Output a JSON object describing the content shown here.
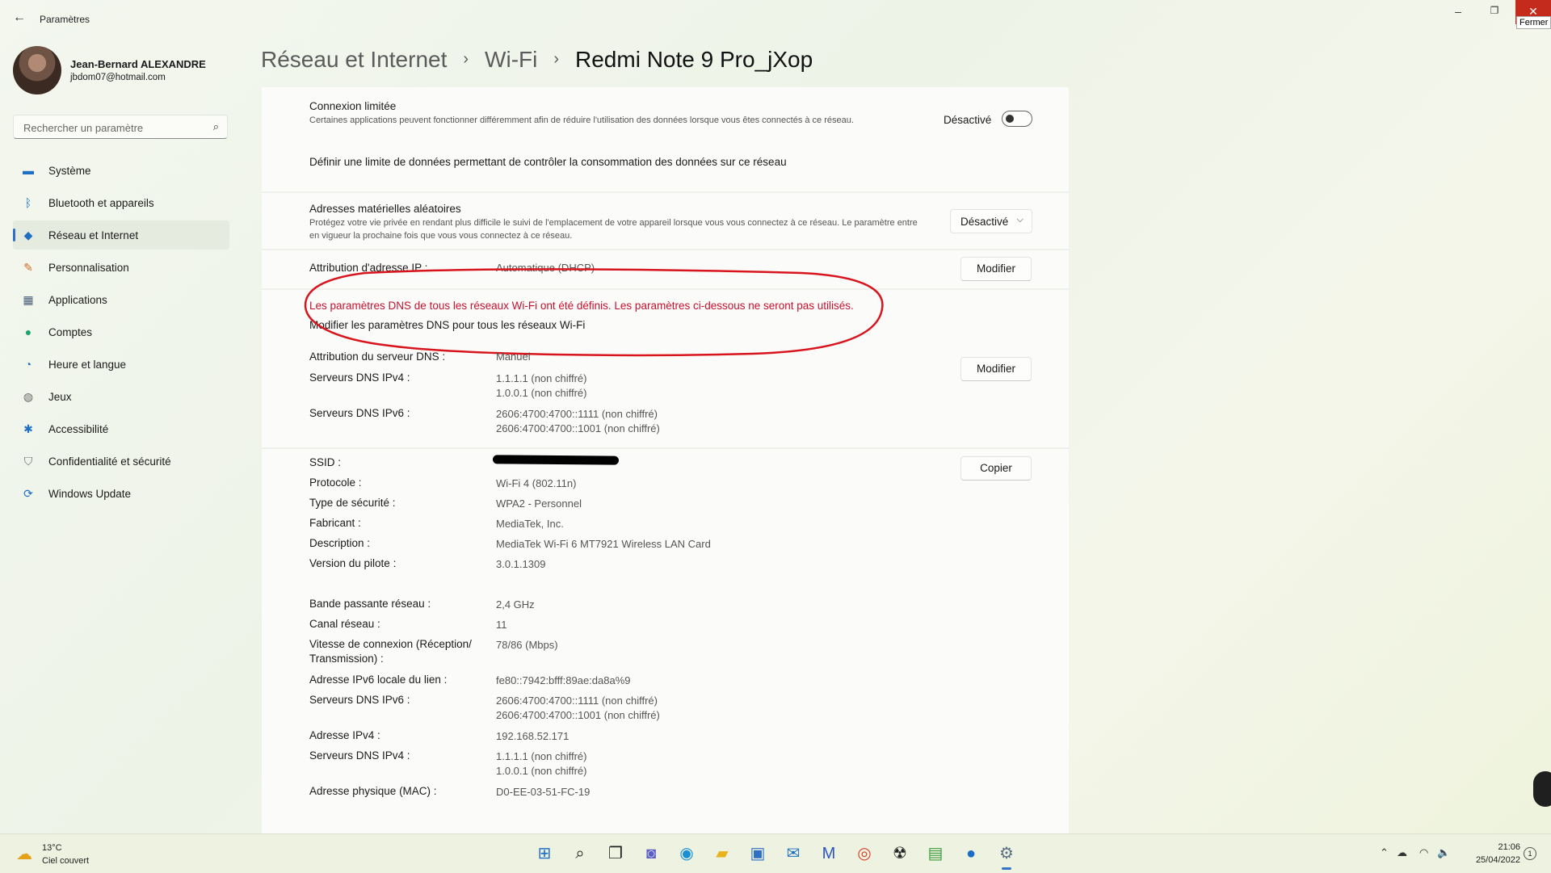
{
  "window": {
    "app_title": "Paramètres",
    "close_tooltip": "Fermer"
  },
  "user": {
    "name": "Jean-Bernard ALEXANDRE",
    "email": "jbdom07@hotmail.com"
  },
  "search": {
    "placeholder": "Rechercher un paramètre"
  },
  "sidebar": {
    "items": [
      {
        "label": "Système",
        "icon": "monitor-icon",
        "color": "#1f6fc4"
      },
      {
        "label": "Bluetooth et appareils",
        "icon": "bluetooth-icon",
        "color": "#1f6fc4"
      },
      {
        "label": "Réseau et Internet",
        "icon": "wifi-icon",
        "color": "#1f6fc4",
        "selected": true
      },
      {
        "label": "Personnalisation",
        "icon": "brush-icon",
        "color": "#d3691e"
      },
      {
        "label": "Applications",
        "icon": "apps-icon",
        "color": "#4a5f7a"
      },
      {
        "label": "Comptes",
        "icon": "person-icon",
        "color": "#1fa36e"
      },
      {
        "label": "Heure et langue",
        "icon": "globe-clock-icon",
        "color": "#1f6fc4"
      },
      {
        "label": "Jeux",
        "icon": "gamepad-icon",
        "color": "#6a6a6a"
      },
      {
        "label": "Accessibilité",
        "icon": "accessibility-icon",
        "color": "#1f6fc4"
      },
      {
        "label": "Confidentialité et sécurité",
        "icon": "shield-icon",
        "color": "#6a6a6a"
      },
      {
        "label": "Windows Update",
        "icon": "update-icon",
        "color": "#1f6fc4"
      }
    ]
  },
  "breadcrumb": {
    "level1": "Réseau et Internet",
    "level2": "Wi-Fi",
    "current": "Redmi Note 9 Pro_jXop",
    "separator": "›"
  },
  "metered": {
    "title": "Connexion limitée",
    "description": "Certaines applications peuvent fonctionner différemment afin de réduire l'utilisation des données lorsque vous êtes connectés à ce réseau.",
    "toggle_label": "Désactivé",
    "data_limit_link": "Définir une limite de données permettant de contrôler la consommation des données sur ce réseau"
  },
  "random_mac": {
    "title": "Adresses matérielles aléatoires",
    "description": "Protégez votre vie privée en rendant plus difficile le suivi de l'emplacement de votre appareil lorsque vous vous connectez à ce réseau. Le paramètre entre en vigueur la prochaine fois que vous vous connectez à ce réseau.",
    "selected": "Désactivé"
  },
  "ip": {
    "label": "Attribution d'adresse IP :",
    "value": "Automatique (DHCP)",
    "button": "Modifier"
  },
  "dns_warning": {
    "text": "Les paramètres DNS de tous les réseaux Wi-Fi ont été définis. Les paramètres ci-dessous ne seront pas utilisés.",
    "link": "Modifier les paramètres DNS pour tous les réseaux Wi-Fi"
  },
  "dns": {
    "assign_label": "Attribution du serveur DNS :",
    "assign_value": "Manuel",
    "ipv4_label": "Serveurs DNS IPv4 :",
    "ipv4_values": [
      "1.1.1.1 (non chiffré)",
      "1.0.0.1 (non chiffré)"
    ],
    "ipv6_label": "Serveurs DNS IPv6 :",
    "ipv6_values": [
      "2606:4700:4700::1111 (non chiffré)",
      "2606:4700:4700::1001 (non chiffré)"
    ],
    "button": "Modifier"
  },
  "properties": {
    "copy_button": "Copier",
    "rows": [
      {
        "label": "SSID :",
        "value": ""
      },
      {
        "label": "Protocole :",
        "value": "Wi-Fi 4 (802.11n)"
      },
      {
        "label": "Type de sécurité :",
        "value": "WPA2 - Personnel"
      },
      {
        "label": "Fabricant :",
        "value": "MediaTek, Inc."
      },
      {
        "label": "Description :",
        "value": "MediaTek Wi-Fi 6 MT7921 Wireless LAN Card"
      },
      {
        "label": "Version du pilote :",
        "value": "3.0.1.1309"
      },
      {
        "label": "Bande passante réseau :",
        "value": "2,4 GHz"
      },
      {
        "label": "Canal réseau :",
        "value": "11"
      },
      {
        "label": "Vitesse de connexion (Réception/",
        "label2": "Transmission) :",
        "value": "78/86 (Mbps)"
      },
      {
        "label": "Adresse IPv6 locale du lien :",
        "value": "fe80::7942:bfff:89ae:da8a%9"
      },
      {
        "label": "Serveurs DNS IPv6 :",
        "value": "2606:4700:4700::1111 (non chiffré)",
        "value2": "2606:4700:4700::1001 (non chiffré)"
      },
      {
        "label": "Adresse IPv4 :",
        "value": "192.168.52.171"
      },
      {
        "label": "Serveurs DNS IPv4 :",
        "value": "1.1.1.1 (non chiffré)",
        "value2": "1.0.0.1 (non chiffré)"
      },
      {
        "label": "Adresse physique (MAC) :",
        "value": "D0-EE-03-51-FC-19"
      }
    ]
  },
  "taskbar": {
    "weather_temp": "13°C",
    "weather_desc": "Ciel couvert",
    "time": "21:06",
    "date": "25/04/2022",
    "notifications": "1",
    "apps": [
      "start-icon",
      "search-icon",
      "task-view-icon",
      "teams-chat-icon",
      "edge-icon",
      "file-explorer-icon",
      "store-icon",
      "mail-icon",
      "malwarebytes-icon",
      "chrome-icon",
      "radiation-app-icon",
      "notepad-icon",
      "droplet-app-icon",
      "settings-icon"
    ]
  }
}
